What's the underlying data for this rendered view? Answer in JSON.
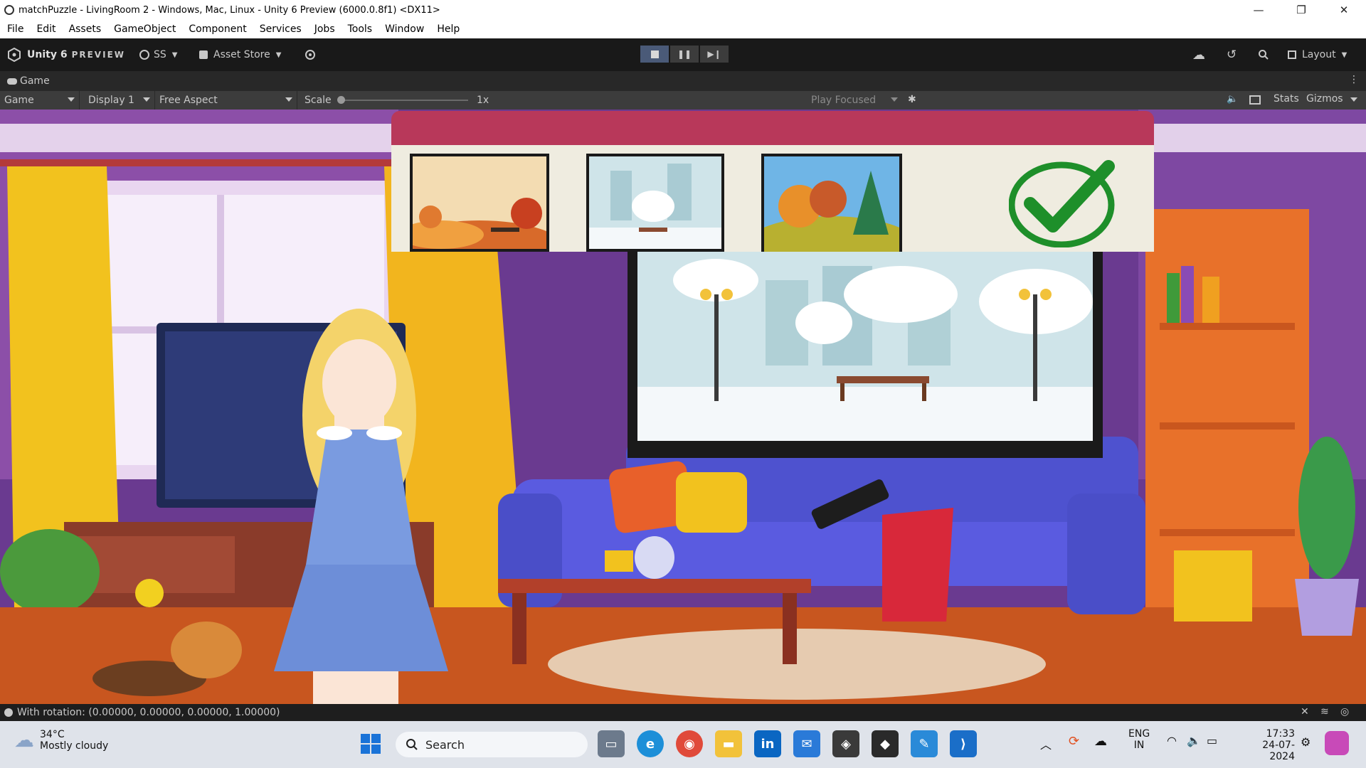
{
  "window": {
    "title": "matchPuzzle - LivingRoom 2 - Windows, Mac, Linux - Unity 6 Preview (6000.0.8f1) <DX11>",
    "controls": [
      "—",
      "❐",
      "✕"
    ]
  },
  "menu": [
    "File",
    "Edit",
    "Assets",
    "GameObject",
    "Component",
    "Services",
    "Jobs",
    "Tools",
    "Window",
    "Help"
  ],
  "toolbar": {
    "unity_label": "Unity 6",
    "preview_label": "PREVIEW",
    "account_label": "SS",
    "asset_store_label": "Asset Store",
    "layout_label": "Layout"
  },
  "game_tab": {
    "label": "Game"
  },
  "game_bar": {
    "view_mode": "Game",
    "display": "Display 1",
    "aspect": "Free Aspect",
    "scale_label": "Scale",
    "scale_value": "1x",
    "play_mode": "Play Focused",
    "stats_label": "Stats",
    "gizmos_label": "Gizmos"
  },
  "puzzle": {
    "thumbnails": [
      "autumn-park-scene",
      "winter-park-scene",
      "forest-hill-scene"
    ],
    "selected_index": 1,
    "solved": true,
    "check_color": "#1e8f2a",
    "header_color": "#b8385a"
  },
  "status": {
    "message": "With rotation: (0.00000, 0.00000, 0.00000, 1.00000)"
  },
  "taskbar": {
    "weather_temp": "34°C",
    "weather_desc": "Mostly cloudy",
    "search_label": "Search",
    "lang_top": "ENG",
    "lang_bottom": "IN",
    "time": "17:33",
    "date": "24-07-2024"
  }
}
